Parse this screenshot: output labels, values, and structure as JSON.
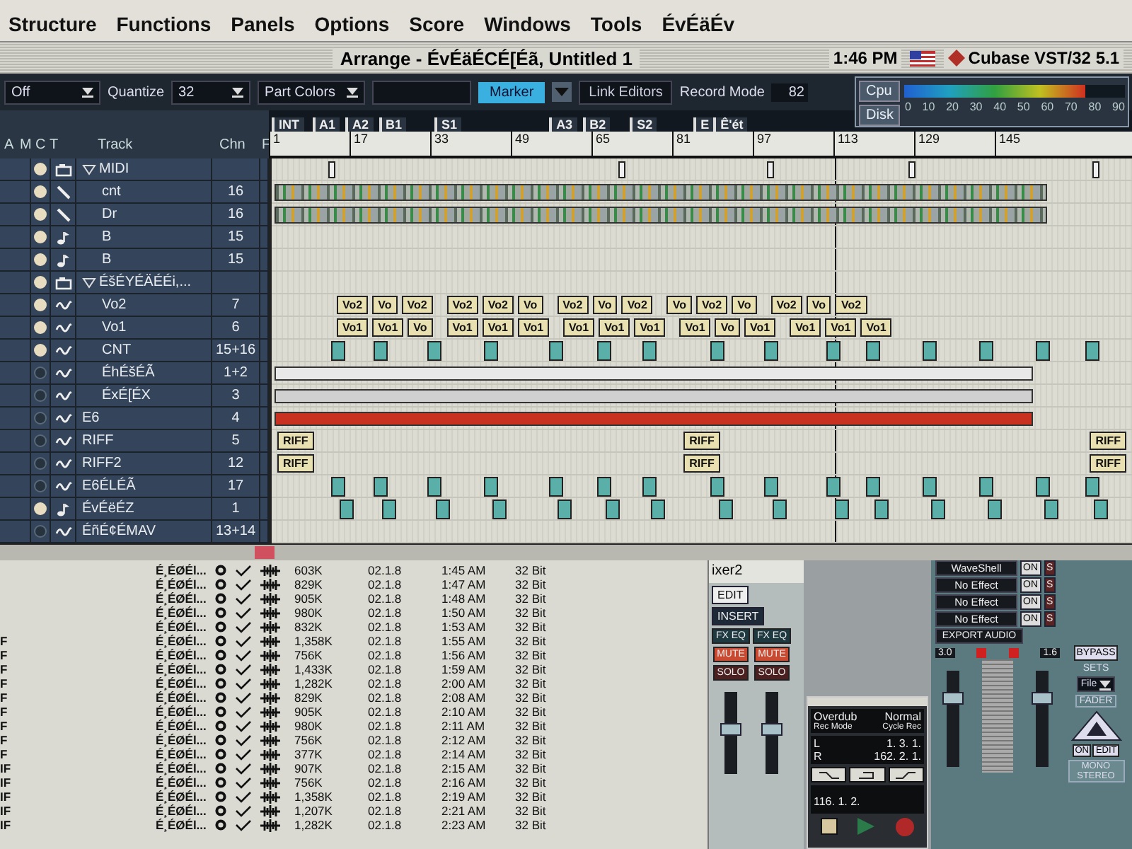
{
  "menu_bar": {
    "items": [
      "Structure",
      "Functions",
      "Panels",
      "Options",
      "Score",
      "Windows",
      "Tools",
      "ÉvÉäÉv"
    ]
  },
  "window": {
    "title": "Arrange - ÉvÉäÉCÉ[Éã, Untitled 1",
    "clock": "1:46 PM",
    "app": "Cubase VST/32 5.1"
  },
  "toolbar": {
    "snap": "Off",
    "quantize_label": "Quantize",
    "quantize": "32",
    "part_colors": "Part Colors",
    "marker": "Marker",
    "link_editors": "Link Editors",
    "record_mode_label": "Record Mode",
    "record_mode": "82"
  },
  "performance": {
    "cpu_label": "Cpu",
    "disk_label": "Disk",
    "cpu_level": {
      "level": 0.82
    },
    "scale": [
      "0",
      "10",
      "20",
      "30",
      "40",
      "50",
      "60",
      "70",
      "80",
      "90"
    ]
  },
  "track_columns": [
    "A",
    "M",
    "C",
    "T",
    "Track",
    "Chn",
    "F"
  ],
  "tracks": [
    {
      "name": "MIDI",
      "kind": "folder",
      "dot": true,
      "expanded": true,
      "lane": {
        "kind": "markers"
      },
      "children": [
        {
          "name": "cnt",
          "chn": "16",
          "kind": "drum",
          "dot": true,
          "lane": {
            "kind": "dense"
          }
        },
        {
          "name": "Dr",
          "chn": "16",
          "kind": "drum",
          "dot": true,
          "lane": {
            "kind": "dense"
          }
        },
        {
          "name": "B",
          "chn": "15",
          "kind": "midi",
          "dot": true
        },
        {
          "name": "B",
          "chn": "15",
          "kind": "midi",
          "dot": true
        }
      ]
    },
    {
      "name": "ÉšÉYÉÄÉÉi,...",
      "kind": "folder",
      "dot": true,
      "expanded": true,
      "children": [
        {
          "name": "Vo2",
          "chn": "7",
          "kind": "audio",
          "dot": true,
          "lane": {
            "kind": "labels",
            "parts": [
              "Vo2",
              "Vo",
              "Vo2",
              "Vo2",
              "Vo2",
              "Vo",
              "Vo2",
              "Vo",
              "Vo2",
              "Vo",
              "Vo2",
              "Vo",
              "Vo2",
              "Vo",
              "Vo2"
            ]
          }
        },
        {
          "name": "Vo1",
          "chn": "6",
          "kind": "audio",
          "dot": true,
          "lane": {
            "kind": "labels",
            "parts": [
              "Vo1",
              "Vo1",
              "Vo",
              "Vo1",
              "Vo1",
              "Vo1",
              "Vo1",
              "Vo1",
              "Vo1",
              "Vo1",
              "Vo",
              "Vo1",
              "Vo1",
              "Vo1",
              "Vo1"
            ]
          }
        },
        {
          "name": "CNT",
          "chn": "15+16",
          "kind": "audio",
          "dot": true,
          "lane": {
            "kind": "clips"
          }
        },
        {
          "name": "ÉhÉšÉÃ",
          "chn": "1+2",
          "kind": "audio",
          "dot": false,
          "lane": {
            "kind": "wave",
            "color": "#e8e8e8"
          }
        },
        {
          "name": "ÉxÉ[ÉX",
          "chn": "3",
          "kind": "audio",
          "dot": false,
          "lane": {
            "kind": "wave",
            "color": "#d0d0d0"
          }
        }
      ]
    },
    {
      "name": "E6",
      "chn": "4",
      "kind": "audio",
      "dot": false,
      "lane": {
        "kind": "wave",
        "color": "#c83020"
      }
    },
    {
      "name": "RIFF",
      "chn": "5",
      "kind": "audio",
      "dot": false,
      "lane": {
        "kind": "labels",
        "parts": [
          "RIFF",
          "RIFF",
          "RIFF"
        ]
      }
    },
    {
      "name": "RIFF2",
      "chn": "12",
      "kind": "audio",
      "dot": false,
      "lane": {
        "kind": "labels",
        "parts": [
          "RIFF",
          "RIFF",
          "RIFF"
        ]
      }
    },
    {
      "name": "E6ÉLÉÃ",
      "chn": "17",
      "kind": "audio",
      "dot": false,
      "lane": {
        "kind": "clips"
      }
    },
    {
      "name": "ÉvÉëÉZ",
      "chn": "1",
      "kind": "midi",
      "dot": true,
      "lane": {
        "kind": "clips"
      }
    },
    {
      "name": "ÉñÉ¢ÉMAV",
      "chn": "13+14",
      "kind": "audio",
      "dot": false
    }
  ],
  "ruler": {
    "markers": [
      "INT",
      "A1",
      "A2",
      "B1",
      "S1",
      "A3",
      "B2",
      "S2",
      "E",
      "Ê'ét"
    ],
    "bars": [
      "1",
      "17",
      "33",
      "49",
      "65",
      "81",
      "97",
      "113",
      "129",
      "145"
    ]
  },
  "file_list": {
    "rows": [
      {
        "name": "É¸ÉØÉl...",
        "size": "603K",
        "version": "02.1.8",
        "time": "1:45 AM",
        "format": "32 Bit"
      },
      {
        "name": "É¸ÉØÉl...",
        "size": "829K",
        "version": "02.1.8",
        "time": "1:47 AM",
        "format": "32 Bit"
      },
      {
        "name": "É¸ÉØÉl...",
        "size": "905K",
        "version": "02.1.8",
        "time": "1:48 AM",
        "format": "32 Bit"
      },
      {
        "name": "É¸ÉØÉl...",
        "size": "980K",
        "version": "02.1.8",
        "time": "1:50 AM",
        "format": "32 Bit"
      },
      {
        "name": "É¸ÉØÉl...",
        "size": "832K",
        "version": "02.1.8",
        "time": "1:53 AM",
        "format": "32 Bit"
      },
      {
        "column_1": "F",
        "name": "É¸ÉØÉl...",
        "size": "1,358K",
        "version": "02.1.8",
        "time": "1:55 AM",
        "format": "32 Bit"
      },
      {
        "column_1": "F",
        "name": "É¸ÉØÉl...",
        "size": "756K",
        "version": "02.1.8",
        "time": "1:56 AM",
        "format": "32 Bit"
      },
      {
        "column_1": "F",
        "name": "É¸ÉØÉl...",
        "size": "1,433K",
        "version": "02.1.8",
        "time": "1:59 AM",
        "format": "32 Bit"
      },
      {
        "column_1": "F",
        "name": "É¸ÉØÉl...",
        "size": "1,282K",
        "version": "02.1.8",
        "time": "2:00 AM",
        "format": "32 Bit"
      },
      {
        "column_1": "F",
        "name": "É¸ÉØÉl...",
        "size": "829K",
        "version": "02.1.8",
        "time": "2:08 AM",
        "format": "32 Bit"
      },
      {
        "column_1": "F",
        "name": "É¸ÉØÉl...",
        "size": "905K",
        "version": "02.1.8",
        "time": "2:10 AM",
        "format": "32 Bit"
      },
      {
        "column_1": "F",
        "name": "É¸ÉØÉl...",
        "size": "980K",
        "version": "02.1.8",
        "time": "2:11 AM",
        "format": "32 Bit"
      },
      {
        "column_1": "F",
        "name": "É¸ÉØÉl...",
        "size": "756K",
        "version": "02.1.8",
        "time": "2:12 AM",
        "format": "32 Bit"
      },
      {
        "column_1": "F",
        "name": "É¸ÉØÉl...",
        "size": "377K",
        "version": "02.1.8",
        "time": "2:14 AM",
        "format": "32 Bit"
      },
      {
        "column_1": "IF",
        "name": "É¸ÉØÉl...",
        "size": "907K",
        "version": "02.1.8",
        "time": "2:15 AM",
        "format": "32 Bit"
      },
      {
        "column_1": "IF",
        "name": "É¸ÉØÉl...",
        "size": "756K",
        "version": "02.1.8",
        "time": "2:16 AM",
        "format": "32 Bit"
      },
      {
        "column_1": "IF",
        "name": "É¸ÉØÉl...",
        "size": "1,358K",
        "version": "02.1.8",
        "time": "2:19 AM",
        "format": "32 Bit"
      },
      {
        "column_1": "IF",
        "name": "É¸ÉØÉl...",
        "size": "1,207K",
        "version": "02.1.8",
        "time": "2:21 AM",
        "format": "32 Bit"
      },
      {
        "column_1": "IF",
        "name": "É¸ÉØÉl...",
        "size": "1,282K",
        "version": "02.1.8",
        "time": "2:23 AM",
        "format": "32 Bit"
      }
    ]
  },
  "mixer": {
    "title": "ixer2",
    "edit": "EDIT",
    "insert": "INSERT",
    "channels": [
      {
        "fx_eq": "FX EQ",
        "mute": "MUTE",
        "solo": "SOLO",
        "level": 0.55
      },
      {
        "fx_eq": "FX EQ",
        "mute": "MUTE",
        "solo": "SOLO",
        "level": 0.55
      }
    ]
  },
  "transport": {
    "rec_mode": "Overdub",
    "cycle_rec": "Normal",
    "rec_mode_label": "Rec Mode",
    "cycle_rec_label": "Cycle Rec",
    "left_label": "L",
    "left": "1. 3. 1.",
    "right_label": "R",
    "right": "162. 2. 1.",
    "position": "116. 1. 2."
  },
  "master": {
    "inserts": [
      {
        "name": "WaveShell",
        "on": "ON",
        "solo": "S"
      },
      {
        "name": "No Effect",
        "on": "ON",
        "solo": "S"
      },
      {
        "name": "No Effect",
        "on": "ON",
        "solo": "S"
      },
      {
        "name": "No Effect",
        "on": "ON",
        "solo": "S"
      }
    ],
    "export": "EXPORT AUDIO",
    "left_value": "3.0",
    "right_value": "1.6",
    "bypass": "BYPASS",
    "sets": "SETS",
    "sets_value": "File",
    "fader": "FADER",
    "on": "ON",
    "edit": "EDIT",
    "mono_stereo": "MONO STEREO",
    "faders": [
      {
        "level": 0.72
      },
      {
        "level": 0.72
      }
    ]
  }
}
